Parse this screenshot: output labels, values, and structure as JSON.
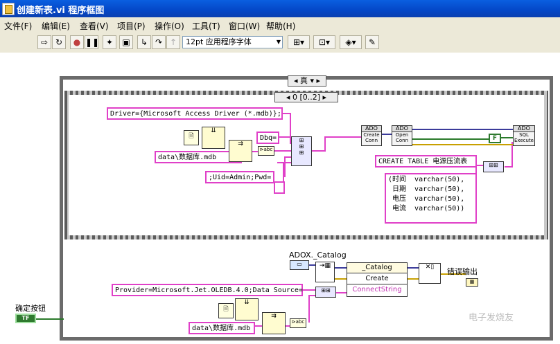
{
  "window": {
    "title": "创建新表.vi 程序框图"
  },
  "menu": [
    "文件(F)",
    "编辑(E)",
    "查看(V)",
    "项目(P)",
    "操作(O)",
    "工具(T)",
    "窗口(W)",
    "帮助(H)"
  ],
  "toolbar": {
    "font": "12pt 应用程序字体"
  },
  "case_structure": {
    "selector": "真"
  },
  "sequence": {
    "selector": "0 [0..2]"
  },
  "constants": {
    "driver": "Driver={Microsoft Access Driver (*.mdb)};",
    "dbq": "Dbq=",
    "dbpath1": "data\\数据库.mdb",
    "uid": ";Uid=Admin;Pwd=",
    "empty": "",
    "create_table": "CREATE TABLE 电源压流表",
    "fields": "(时间  varchar(50),\n 日期  varchar(50),\n 电压  varchar(50),\n 电流  varchar(50))",
    "provider": "Provider=Microsoft.Jet.OLEDB.4.0;Data Source=",
    "dbpath2": "data\\数据库.mdb"
  },
  "nodes": {
    "ado1_hd": "ADO",
    "ado1_body": "Create\nConn",
    "ado2_hd": "ADO",
    "ado2_body": "Open\nConn",
    "ado3_hd": "ADO",
    "ado3_body": "SQL\nExecute",
    "false_const": "F",
    "adox_label": "ADOX._Catalog",
    "catalog_hd": "_Catalog",
    "catalog_create": "Create",
    "catalog_conn": "ConnectString"
  },
  "labels": {
    "error_out": "错误输出",
    "ok_button": "确定按钮",
    "bool_tf": "TF"
  },
  "watermark": "电子发烧友"
}
